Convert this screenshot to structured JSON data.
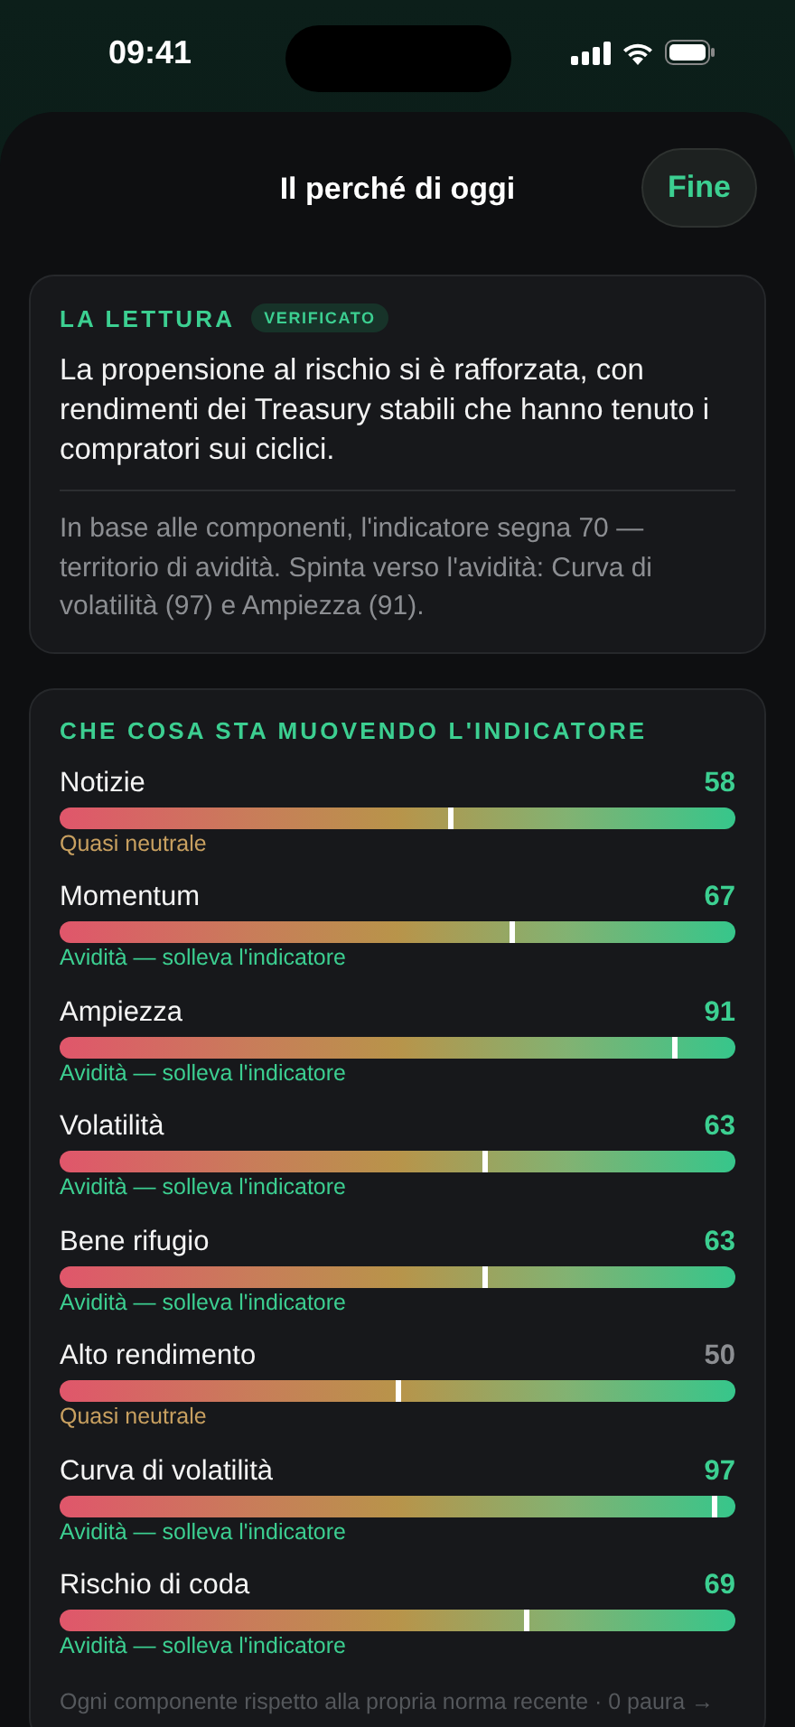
{
  "status_bar": {
    "time": "09:41"
  },
  "header": {
    "title": "Il perché di oggi",
    "done_button": "Fine"
  },
  "reading": {
    "label": "LA LETTURA",
    "badge": "VERIFICATO",
    "summary": "La propensione al rischio si è rafforzata, con rendimenti dei Treasury stabili che hanno tenuto i compratori sui ciclici.",
    "detail": "In base alle componenti, l'indicatore segna 70 — territorio di avidità. Spinta verso l'avidità: Curva di volatilità (97) e Ampiezza (91)."
  },
  "drivers": {
    "title": "CHE COSA STA MUOVENDO L'INDICATORE",
    "items": [
      {
        "name": "Notizie",
        "value": "58",
        "level": 0.58,
        "kind": "neutral",
        "note": "Quasi neutrale"
      },
      {
        "name": "Momentum",
        "value": "67",
        "level": 0.67,
        "kind": "greed",
        "note": "Avidità — solleva l'indicatore"
      },
      {
        "name": "Ampiezza",
        "value": "91",
        "level": 0.91,
        "kind": "greed",
        "note": "Avidità — solleva l'indicatore"
      },
      {
        "name": "Volatilità",
        "value": "63",
        "level": 0.63,
        "kind": "greed",
        "note": "Avidità — solleva l'indicatore"
      },
      {
        "name": "Bene rifugio",
        "value": "63",
        "level": 0.63,
        "kind": "greed",
        "note": "Avidità — solleva l'indicatore"
      },
      {
        "name": "Alto rendimento",
        "value": "50",
        "level": 0.5,
        "kind": "neutral",
        "note": "Quasi neutrale"
      },
      {
        "name": "Curva di volatilità",
        "value": "97",
        "level": 0.97,
        "kind": "greed",
        "note": "Avidità — solleva l'indicatore"
      },
      {
        "name": "Rischio di coda",
        "value": "69",
        "level": 0.69,
        "kind": "greed",
        "note": "Avidità — solleva l'indicatore"
      }
    ],
    "footnote": "Ogni componente rispetto alla propria norma recente · 0 paura →"
  }
}
